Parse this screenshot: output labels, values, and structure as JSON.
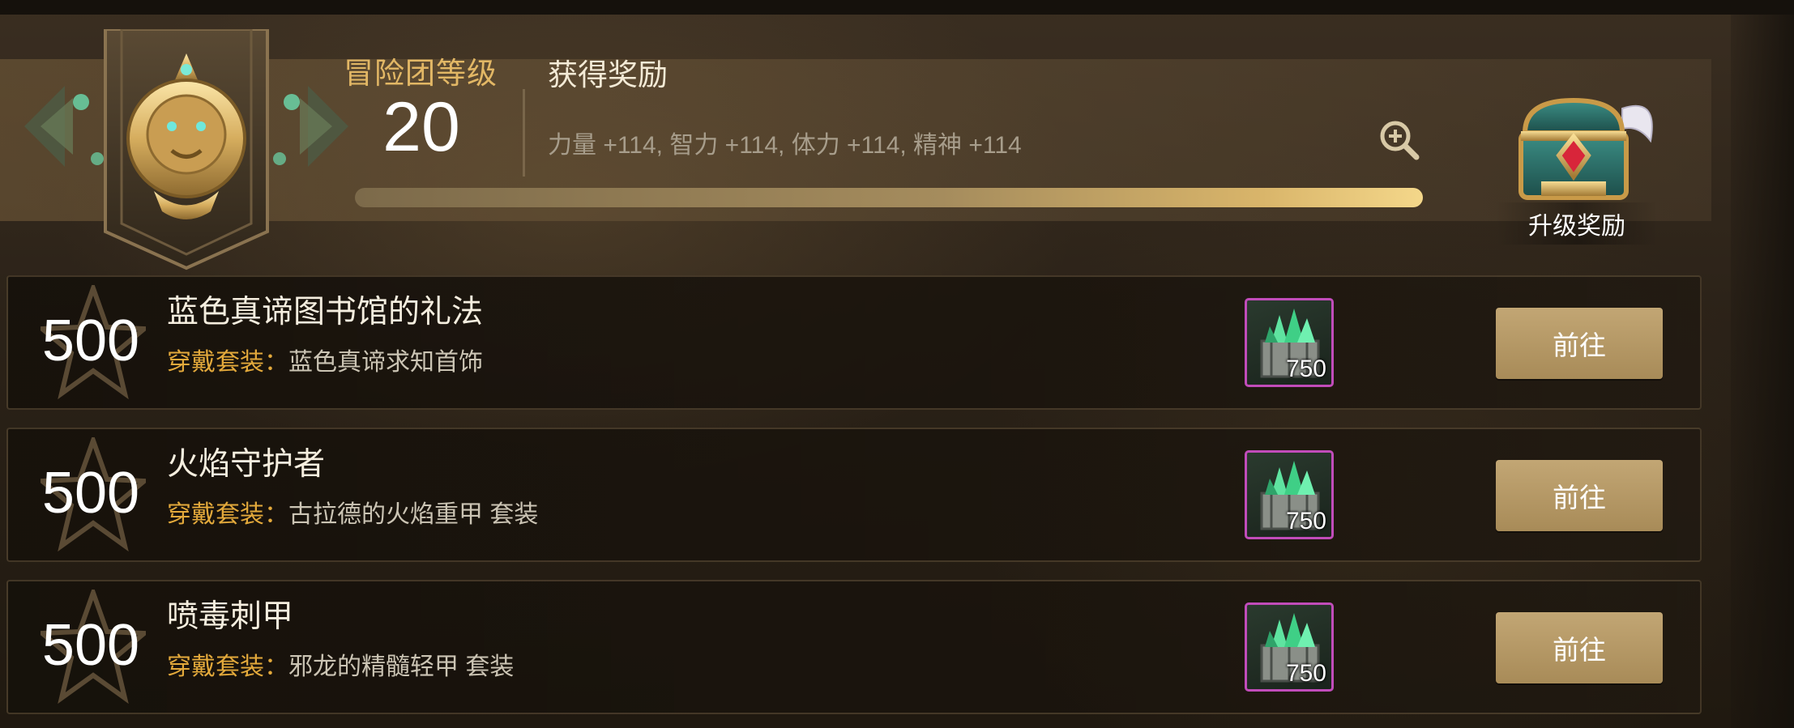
{
  "header": {
    "level_label": "冒险团等级",
    "level_value": "20",
    "reward_label": "获得奖励",
    "reward_stats": "力量 +114, 智力 +114, 体力 +114, 精神 +114",
    "progress": 1.0,
    "zoom_icon": "zoom-in-icon",
    "upgrade_label": "升级奖励",
    "emblem_icon": "lion-crest-icon",
    "chest_icon": "treasure-chest-icon"
  },
  "colors": {
    "gold_label": "#e2b765",
    "set_key": "#e3a93b",
    "button": "#b79a66",
    "item_border": "#c14cba"
  },
  "rows": [
    {
      "points": "500",
      "title": "蓝色真谛图书馆的礼法",
      "set_key": "穿戴套装：",
      "set_value": "蓝色真谛求知首饰",
      "item_icon": "green-crystal-basket-icon",
      "item_qty": "750",
      "button": "前往"
    },
    {
      "points": "500",
      "title": "火焰守护者",
      "set_key": "穿戴套装：",
      "set_value": "古拉德的火焰重甲 套装",
      "item_icon": "green-crystal-basket-icon",
      "item_qty": "750",
      "button": "前往"
    },
    {
      "points": "500",
      "title": "喷毒刺甲",
      "set_key": "穿戴套装：",
      "set_value": "邪龙的精髓轻甲 套装",
      "item_icon": "green-crystal-basket-icon",
      "item_qty": "750",
      "button": "前往"
    }
  ]
}
